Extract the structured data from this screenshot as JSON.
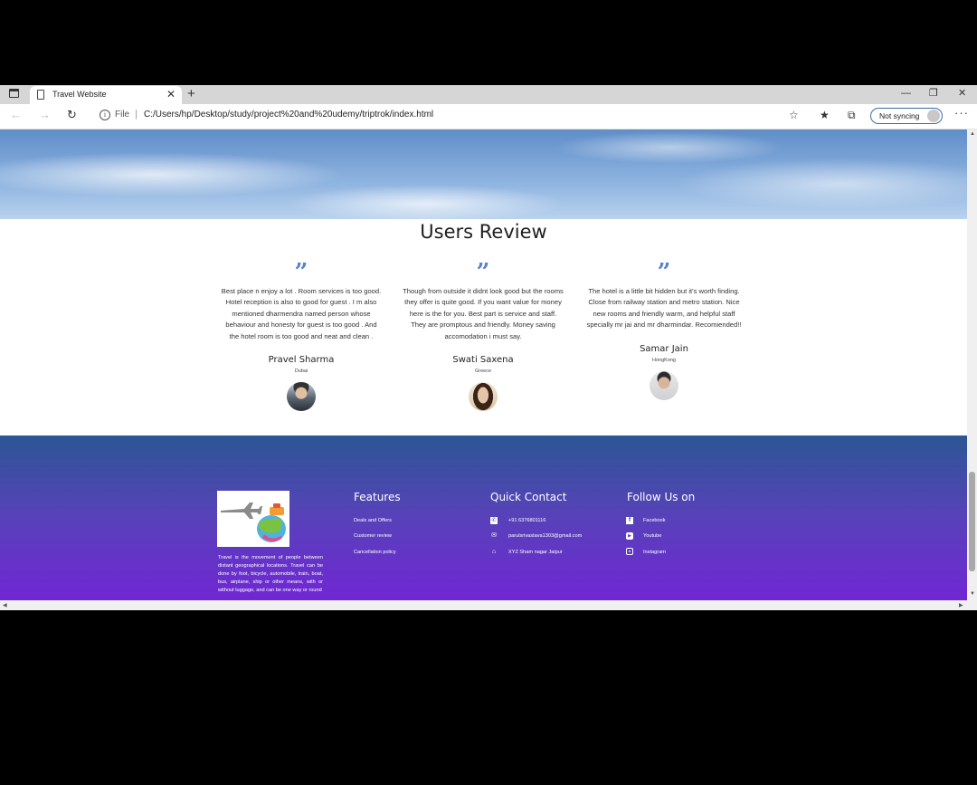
{
  "browser": {
    "tab_title": "Travel Website",
    "address_scheme": "File",
    "url": "C:/Users/hp/Desktop/study/project%20and%20udemy/triptrok/index.html",
    "sync_label": "Not syncing"
  },
  "reviews": {
    "title": "Users Review",
    "items": [
      {
        "text": "Best place n enjoy a lot . Room services is too good. Hotel reception is also to good for guest . I m also mentioned dharmendra named person whose behaviour and honesty for guest is too good . And the hotel room is too good and neat and clean .",
        "name": "Pravel Sharma",
        "location": "Dubai"
      },
      {
        "text": "Though from outside it didnt look good but the rooms they offer is quite good. If you want value for money here is the for you. Best part is service and staff. They are promptous and friendly. Money saving accomodation i must say.",
        "name": "Swati Saxena",
        "location": "Greece"
      },
      {
        "text": "The hotel is a little bit hidden but it's worth finding. Close from railway station and metro station. Nice new rooms and friendly warm, and helpful staff specially mr jai and mr dharmindar. Recomiended!!",
        "name": "Samar Jain",
        "location": "HongKong"
      }
    ]
  },
  "footer": {
    "about": "Travel is the movement of people between distant geographical locations. Travel can be done by foot, bicycle, automobile, train, boat, bus, airplane, ship or other means, with or without luggage, and can be one way or round",
    "features": {
      "title": "Features",
      "links": [
        "Deals and Offers",
        "Customer review",
        "Cancellation policy"
      ]
    },
    "contact": {
      "title": "Quick Contact",
      "phone": "+91 6376801116",
      "email": "parulsrivastava1303@gmail.com",
      "address": "XYZ Sham nagar Jaipur"
    },
    "follow": {
      "title": "Follow Us on",
      "links": [
        "Facebook",
        "Youtube",
        "Instagram"
      ]
    }
  },
  "colors": {
    "quote_accent": "#5a84c8",
    "footer_gradient_top": "#2b5694",
    "footer_gradient_bottom": "#7324d6"
  },
  "icons": [
    "window-menu-icon",
    "page-icon",
    "close-icon",
    "plus-icon",
    "back-arrow-icon",
    "forward-arrow-icon",
    "refresh-icon",
    "info-icon",
    "add-favorite-icon",
    "favorites-icon",
    "collections-icon",
    "profile-avatar-icon",
    "more-icon",
    "quote-icon",
    "phone-icon",
    "mail-icon",
    "home-icon",
    "facebook-icon",
    "youtube-icon",
    "instagram-icon"
  ]
}
